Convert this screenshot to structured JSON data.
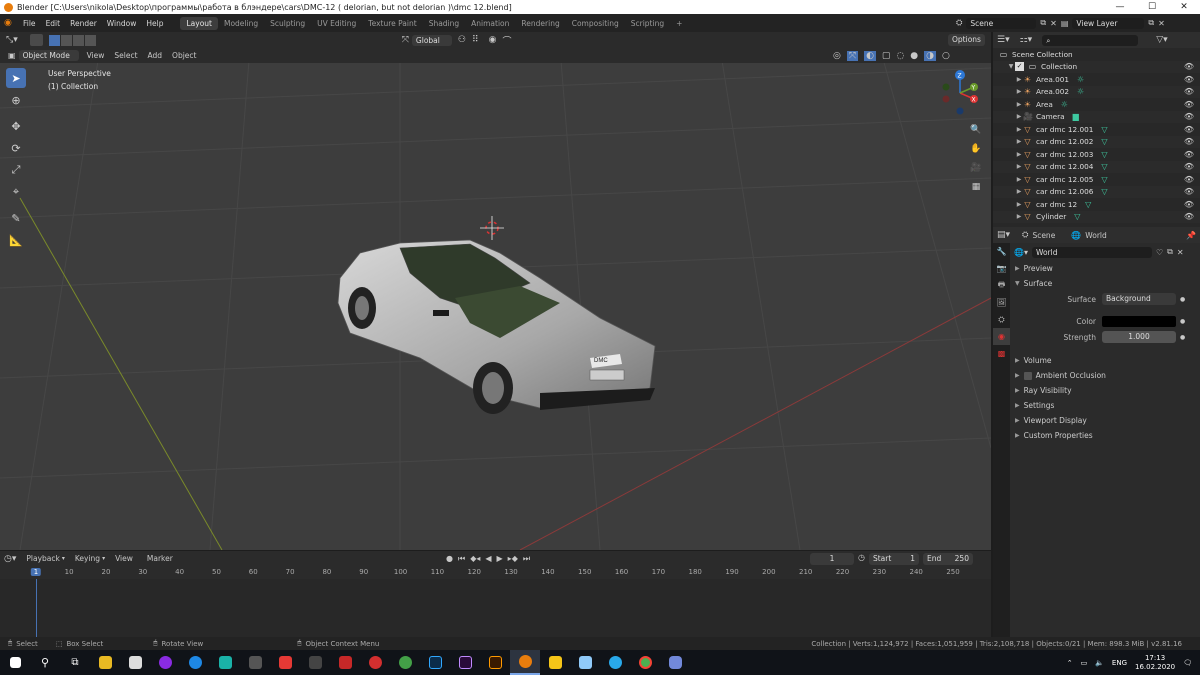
{
  "titlebar": {
    "title": "Blender [C:\\Users\\nikola\\Desktop\\программы\\работа в блэндере\\cars\\DMC-12 ( delorian, but not delorian )\\dmc 12.blend]",
    "minimize": "—",
    "maximize": "☐",
    "close": "✕"
  },
  "menu": [
    "File",
    "Edit",
    "Render",
    "Window",
    "Help"
  ],
  "workspaces": [
    "Layout",
    "Modeling",
    "Sculpting",
    "UV Editing",
    "Texture Paint",
    "Shading",
    "Animation",
    "Rendering",
    "Compositing",
    "Scripting"
  ],
  "active_workspace": "Layout",
  "add_workspace": "+",
  "scene": {
    "label": "Scene",
    "view_layer": "View Layer"
  },
  "viewport_header": {
    "mode": "Object Mode",
    "items": [
      "View",
      "Select",
      "Add",
      "Object"
    ],
    "orientation": "Global",
    "options": "Options"
  },
  "viewport_info": {
    "line1": "User Perspective",
    "line2": "(1) Collection"
  },
  "gizmo_axes": {
    "z": "Z",
    "y": "Y",
    "x": "X"
  },
  "car_plate": "DMC",
  "outliner": {
    "root": "Scene Collection",
    "collection": "Collection",
    "items": [
      {
        "name": "Area.001",
        "icon": "light-icon"
      },
      {
        "name": "Area.002",
        "icon": "light-icon"
      },
      {
        "name": "Area",
        "icon": "light-icon"
      },
      {
        "name": "Camera",
        "icon": "camera-icon"
      },
      {
        "name": "car dmc 12.001",
        "icon": "mesh-icon"
      },
      {
        "name": "car dmc 12.002",
        "icon": "mesh-icon"
      },
      {
        "name": "car dmc 12.003",
        "icon": "mesh-icon"
      },
      {
        "name": "car dmc 12.004",
        "icon": "mesh-icon"
      },
      {
        "name": "car dmc 12.005",
        "icon": "mesh-icon"
      },
      {
        "name": "car dmc 12.006",
        "icon": "mesh-icon"
      },
      {
        "name": "car dmc 12",
        "icon": "mesh-icon"
      },
      {
        "name": "Cylinder",
        "icon": "mesh-icon"
      }
    ]
  },
  "properties": {
    "breadcrumb_scene": "Scene",
    "breadcrumb_world": "World",
    "world_name": "World",
    "sections": {
      "preview": "Preview",
      "surface": "Surface",
      "volume": "Volume",
      "ambient_occlusion": "Ambient Occlusion",
      "ray_visibility": "Ray Visibility",
      "settings": "Settings",
      "viewport_display": "Viewport Display",
      "custom_properties": "Custom Properties"
    },
    "surface_label": "Surface",
    "surface_value": "Background",
    "color_label": "Color",
    "color_value": "#000000",
    "strength_label": "Strength",
    "strength_value": "1.000"
  },
  "timeline": {
    "items": [
      "Playback",
      "Keying",
      "View",
      "Marker"
    ],
    "current_frame": "1",
    "start_label": "Start",
    "start": "1",
    "end_label": "End",
    "end": "250",
    "ruler": [
      "1",
      "10",
      "20",
      "30",
      "40",
      "50",
      "60",
      "70",
      "80",
      "90",
      "100",
      "110",
      "120",
      "130",
      "140",
      "150",
      "160",
      "170",
      "180",
      "190",
      "200",
      "210",
      "220",
      "230",
      "240",
      "250"
    ]
  },
  "statusbar": {
    "select": "Select",
    "box_select": "Box Select",
    "rotate_view": "Rotate View",
    "context_menu": "Object Context Menu",
    "stats": "Collection | Verts:1,124,972 | Faces:1,051,959 | Tris:2,108,718 | Objects:0/21 | Mem: 898.3 MiB | v2.81.16"
  },
  "taskbar": {
    "lang": "ENG",
    "time": "17:13",
    "date": "16.02.2020"
  }
}
